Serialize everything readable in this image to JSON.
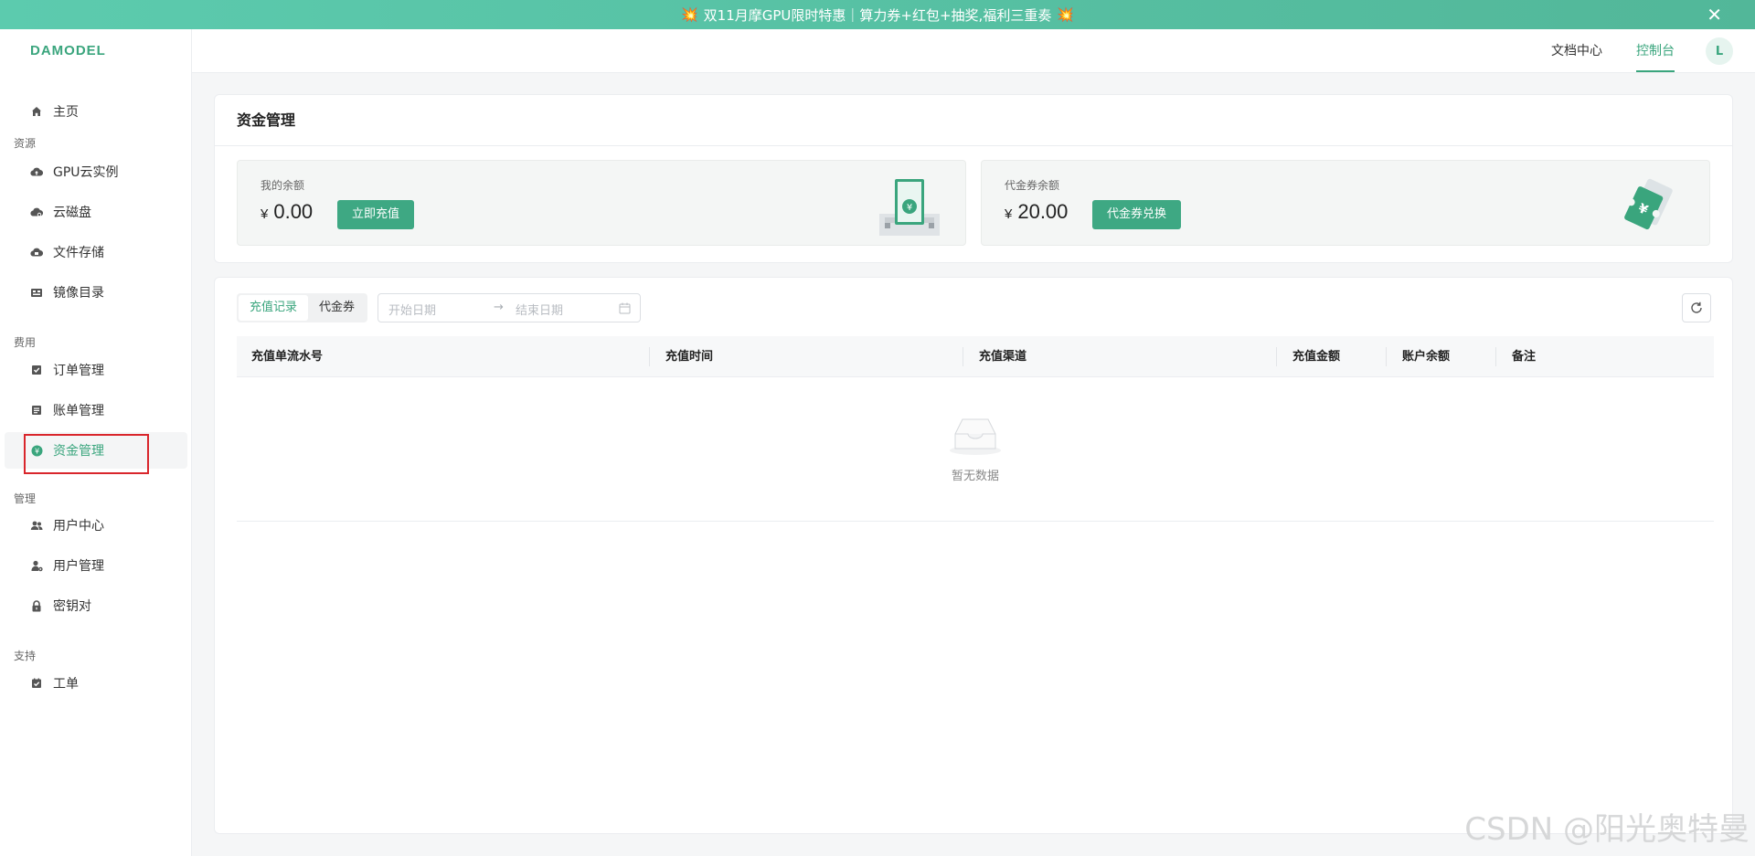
{
  "banner": {
    "text": "双11月摩GPU限时特惠｜算力券+红包+抽奖,福利三重奏",
    "emoji": "💥",
    "close_glyph": "✕"
  },
  "brand": {
    "logo": "DAMODEL",
    "accent": "#3aa57d"
  },
  "sidebar": {
    "home": "主页",
    "groups": {
      "resources": "资源",
      "billing": "费用",
      "management": "管理",
      "support": "支持"
    },
    "items": {
      "gpu": "GPU云实例",
      "disk": "云磁盘",
      "file_storage": "文件存储",
      "image_catalog": "镜像目录",
      "orders": "订单管理",
      "bills": "账单管理",
      "funds": "资金管理",
      "user_center": "用户中心",
      "user_management": "用户管理",
      "key_pair": "密钥对",
      "ticket": "工单"
    }
  },
  "topbar": {
    "docs": "文档中心",
    "console": "控制台",
    "avatar": "L"
  },
  "funds_card": {
    "title": "资金管理",
    "balance": {
      "label": "我的余额",
      "currency": "¥",
      "amount": "0.00",
      "button": "立即充值"
    },
    "voucher": {
      "label": "代金券余额",
      "currency": "¥",
      "amount": "20.00",
      "button": "代金券兑换"
    }
  },
  "records_card": {
    "tabs": [
      "充值记录",
      "代金券"
    ],
    "date_start_placeholder": "开始日期",
    "date_end_placeholder": "结束日期",
    "date_arrow": "→",
    "columns": [
      "充值单流水号",
      "充值时间",
      "充值渠道",
      "充值金额",
      "账户余额",
      "备注"
    ],
    "empty_text": "暂无数据"
  },
  "watermark": "CSDN @阳光奥特曼"
}
